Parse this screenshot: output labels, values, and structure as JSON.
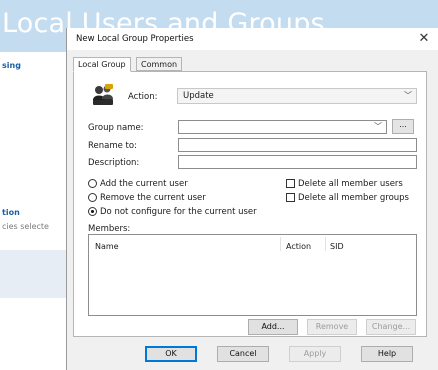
{
  "background": {
    "title": "Local Users and Groups",
    "sidebar": {
      "top_item": "sing",
      "section_heading": "tion",
      "section_note": "cies selecte"
    }
  },
  "dialog": {
    "title": "New Local Group Properties",
    "close_label": "✕",
    "tabs": [
      {
        "label": "Local Group",
        "active": true
      },
      {
        "label": "Common",
        "active": false
      }
    ],
    "action": {
      "label": "Action:",
      "selected": "Update",
      "icon": "users-group-icon"
    },
    "fields": {
      "group_name": {
        "label": "Group name:",
        "value": ""
      },
      "rename_to": {
        "label": "Rename to:",
        "value": ""
      },
      "description": {
        "label": "Description:",
        "value": ""
      },
      "browse_label": "..."
    },
    "radios": [
      {
        "label": "Add the current user",
        "checked": false
      },
      {
        "label": "Remove the current user",
        "checked": false
      },
      {
        "label": "Do not configure for the current user",
        "checked": true
      }
    ],
    "checkboxes": [
      {
        "label": "Delete all member users",
        "checked": false
      },
      {
        "label": "Delete all member groups",
        "checked": false
      }
    ],
    "members": {
      "label": "Members:",
      "columns": [
        "Name",
        "Action",
        "SID"
      ],
      "rows": []
    },
    "member_buttons": {
      "add": "Add...",
      "remove": "Remove",
      "change": "Change..."
    },
    "footer": {
      "ok": "OK",
      "cancel": "Cancel",
      "apply": "Apply",
      "help": "Help"
    }
  }
}
